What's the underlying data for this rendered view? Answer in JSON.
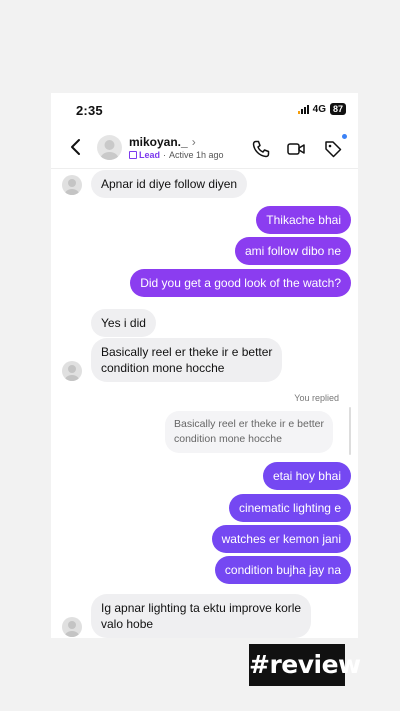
{
  "status_bar": {
    "time": "2:35",
    "network": "4G",
    "battery": "87"
  },
  "header": {
    "username": "mikoyan._",
    "lead_label": "Lead",
    "separator": "·",
    "active_status": "Active 1h ago",
    "icons": [
      "back-icon",
      "phone-icon",
      "video-icon",
      "tag-icon"
    ],
    "accent_color": "#7c3aed"
  },
  "messages": [
    {
      "side": "in",
      "text": "Apnar id diye follow diyen"
    },
    {
      "side": "out",
      "text": "Thikache bhai"
    },
    {
      "side": "out",
      "text": "ami follow dibo ne"
    },
    {
      "side": "out",
      "text": "Did you get a good look of the watch?"
    },
    {
      "side": "in",
      "text": "Yes i did"
    },
    {
      "side": "in",
      "text": "Basically reel er theke ir e better condition mone hocche"
    },
    {
      "side": "out",
      "text": "etai hoy bhai"
    },
    {
      "side": "out",
      "text": "cinematic lighting e"
    },
    {
      "side": "out",
      "text": "watches er kemon jani"
    },
    {
      "side": "out",
      "text": "condition bujha jay na"
    },
    {
      "side": "in",
      "text": "Ig apnar lighting ta ektu improve korle valo hobe"
    }
  ],
  "reply": {
    "label": "You replied",
    "quoted_line1": "Basically reel er theke ir e better",
    "quoted_line2": "condition mone hocche"
  },
  "multiline": {
    "m5_line1": "Basically reel er theke ir e better",
    "m5_line2": "condition mone hocche",
    "m10_line1": "Ig apnar lighting ta ektu improve korle",
    "m10_line2": "valo hobe"
  },
  "sticker": {
    "text": "#review"
  },
  "colors": {
    "outgoing_purple": "#8b3df0",
    "outgoing_violet": "#7548f2",
    "incoming_gray": "#efeff1"
  }
}
